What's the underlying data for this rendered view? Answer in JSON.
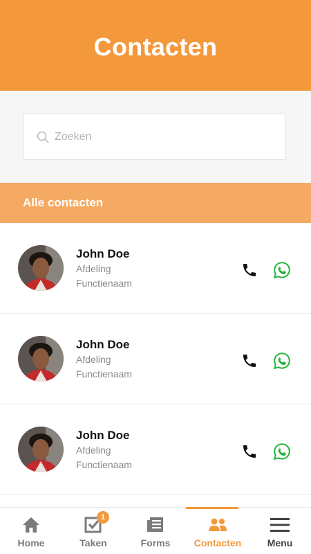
{
  "header": {
    "title": "Contacten"
  },
  "search": {
    "placeholder": "Zoeken",
    "value": ""
  },
  "section": {
    "title": "Alle contacten"
  },
  "contacts": [
    {
      "name": "John Doe",
      "department": "Afdeling",
      "function": "Functienaam"
    },
    {
      "name": "John Doe",
      "department": "Afdeling",
      "function": "Functienaam"
    },
    {
      "name": "John Doe",
      "department": "Afdeling",
      "function": "Functienaam"
    }
  ],
  "tabbar": {
    "tabs": [
      {
        "label": "Home",
        "icon": "home-icon"
      },
      {
        "label": "Taken",
        "icon": "checkbox-icon",
        "badge": "1"
      },
      {
        "label": "Forms",
        "icon": "document-icon"
      },
      {
        "label": "Contacten",
        "icon": "people-icon",
        "active": true
      },
      {
        "label": "Menu",
        "icon": "hamburger-icon"
      }
    ]
  },
  "colors": {
    "brand": "#f4983c",
    "section_bar": "#f4aa62",
    "whatsapp": "#25b33a"
  }
}
